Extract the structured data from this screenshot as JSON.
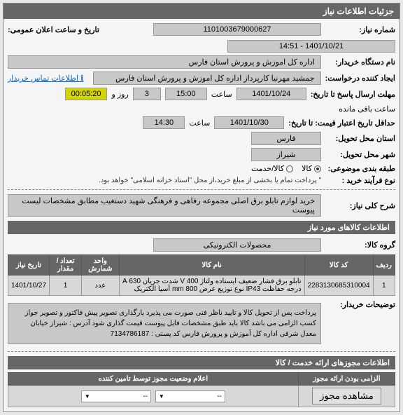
{
  "panel_title": "جزئیات اطلاعات نیاز",
  "fields": {
    "need_number_label": "شماره نیاز:",
    "need_number": "1101003679000627",
    "public_datetime_label": "تاریخ و ساعت اعلان عمومی:",
    "public_datetime": "1401/10/21 - 14:51",
    "buyer_label": "نام دستگاه خریدار:",
    "buyer": "اداره کل اموزش و پرورش استان فارس",
    "requester_label": "ایجاد کننده درخواست:",
    "requester": "جمشید مهرنیا کارپرداز اداره کل اموزش و پرورش استان فارس",
    "contact_link": "اطلاعات تماس خریدار",
    "deadline_label": "مهلت ارسال پاسخ تا تاریخ:",
    "deadline_date": "1401/10/24",
    "deadline_time_label": "ساعت",
    "deadline_time": "15:00",
    "days": "3",
    "days_label": "روز و",
    "countdown": "00:05:20",
    "remaining_label": "ساعت باقی مانده",
    "validity_label": "حداقل تاریخ اعتبار قیمت: تا تاریخ:",
    "validity_date": "1401/10/30",
    "validity_time_label": "ساعت",
    "validity_time": "14:30",
    "province_label": "استان محل تحویل:",
    "province": "فارس",
    "city_label": "شهر محل تحویل:",
    "city": "شیراز",
    "category_label": "طبقه بندی موضوعی:",
    "cat_goods": "کالا",
    "cat_service": "کالا/خدمت",
    "process_label": "نوع فرآیند خرید :",
    "process_note": "\" پرداخت تمام یا بخشی از مبلغ خرید،از محل \"اسناد خزانه اسلامی\" خواهد بود."
  },
  "need_desc": {
    "header": "شرح کلی نیاز:",
    "text": "خرید لوازم تابلو برق اصلی مجموعه رفاهی و فرهنگی شهید دستغیب مطابق مشخصات لیست پیوست"
  },
  "items_header": "اطلاعات کالاهای مورد نیاز",
  "group_label": "گروه کالا:",
  "group_value": "محصولات الکترونیکی",
  "table": {
    "headers": {
      "row": "ردیف",
      "code": "کد کالا",
      "name": "نام کالا",
      "unit": "واحد شمارش",
      "qty": "تعداد / مقدار",
      "date": "تاریخ نیاز"
    },
    "rows": [
      {
        "row": "1",
        "code": "2283130685310004",
        "name": "تابلو برق فشار ضعیف ایستاده ولتاژ V 400 شدت جریان 630 A درجه حفاظت IP43 نوع توزیع عرض mm 800 آسیا الکتریک",
        "unit": "عدد",
        "qty": "1",
        "date": "1401/10/27"
      }
    ]
  },
  "buyer_notes": {
    "label": "توضیحات خریدار:",
    "text": "پرداخت پس از تحویل کالا و تایید ناظر فنی صورت می پذیرد بارگذاری تصویر پیش فاکتور و تصویر جواز کسب الزامی می باشد کالا باید طبق مشخصات فایل پیوست قیمت گذاری شود\nآدرس : شیراز خیابان معدل شرقی اداره کل آموزش و پرورش فارس کد پستی : 7134786187"
  },
  "license_header": "اطلاعات مجوزهای ارائه خدمت / کالا",
  "license_table": {
    "col1": "الزامی بودن ارائه مجوز",
    "col2": "اعلام وضعیت مجوز توسط تامین کننده"
  },
  "select_placeholder": "--",
  "view_btn": "مشاهده مجوز"
}
